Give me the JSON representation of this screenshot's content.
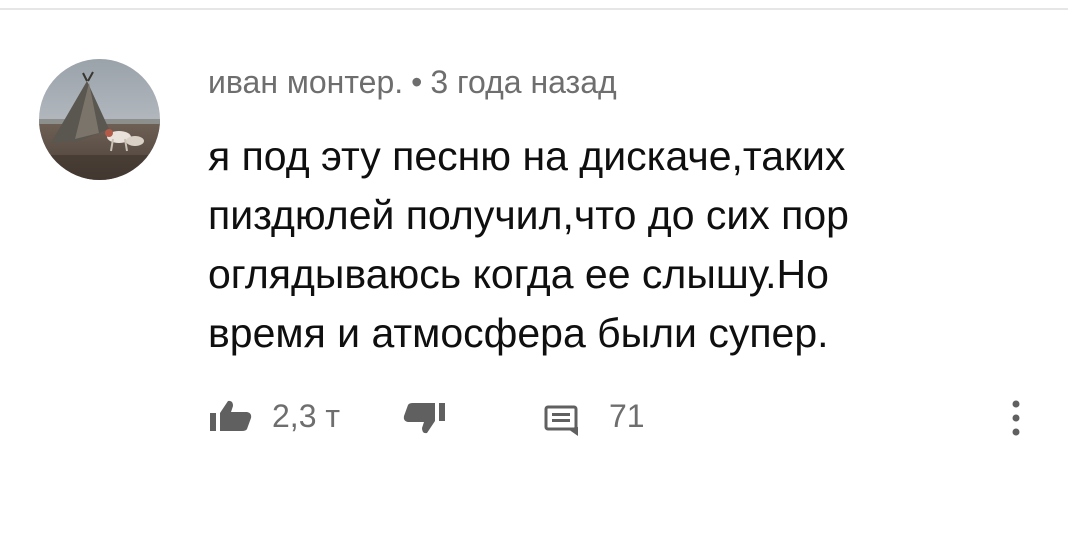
{
  "comment": {
    "author": "иван монтер.",
    "separator": "•",
    "timestamp": "3 года назад",
    "text_lines": [
      "я под эту песню на дискаче,таких",
      "пиздюлей получил,что до сих пор",
      "оглядываюсь когда ее слышу.Но",
      "время и атмосфера были супер."
    ],
    "likes": "2,3 т",
    "replies": "71"
  },
  "icons": {
    "avatar": "avatar-image",
    "like": "thumbs-up-icon",
    "dislike": "thumbs-down-icon",
    "reply": "comment-icon",
    "more": "more-vertical-icon"
  },
  "colors": {
    "text_primary": "#0f0f0f",
    "text_secondary": "#6e6e6e",
    "icon": "#606060",
    "divider": "#e6e6e6"
  }
}
